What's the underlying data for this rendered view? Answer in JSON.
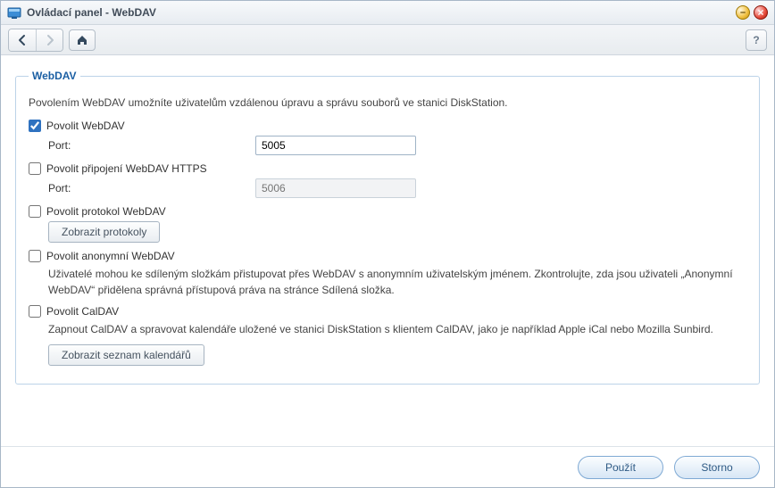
{
  "window": {
    "title": "Ovládací panel - WebDAV"
  },
  "group": {
    "legend": "WebDAV",
    "description": "Povolením WebDAV umožníte uživatelům vzdálenou úpravu a správu souborů ve stanici DiskStation."
  },
  "webdav": {
    "enable_label": "Povolit WebDAV",
    "enable_checked": true,
    "port_label": "Port:",
    "port_value": "5005"
  },
  "https": {
    "enable_label": "Povolit připojení WebDAV HTTPS",
    "enable_checked": false,
    "port_label": "Port:",
    "port_placeholder": "5006"
  },
  "log": {
    "enable_label": "Povolit protokol WebDAV",
    "enable_checked": false,
    "view_button": "Zobrazit protokoly"
  },
  "anon": {
    "enable_label": "Povolit anonymní WebDAV",
    "enable_checked": false,
    "note": "Uživatelé mohou ke sdíleným složkám přistupovat přes WebDAV s anonymním uživatelským jménem. Zkontrolujte, zda jsou uživateli „Anonymní WebDAV“ přidělena správná přístupová práva na stránce Sdílená složka."
  },
  "caldav": {
    "enable_label": "Povolit CalDAV",
    "enable_checked": false,
    "note": "Zapnout CalDAV a spravovat kalendáře uložené ve stanici DiskStation s klientem CalDAV, jako je například Apple iCal nebo Mozilla Sunbird.",
    "list_button": "Zobrazit seznam kalendářů"
  },
  "footer": {
    "apply": "Použít",
    "cancel": "Storno"
  },
  "help_glyph": "?"
}
